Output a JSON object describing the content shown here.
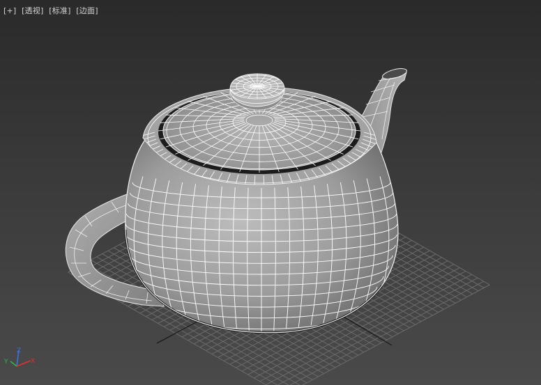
{
  "viewport": {
    "menus": [
      {
        "id": "plus",
        "label": "[+]"
      },
      {
        "id": "view",
        "label": "[透视]"
      },
      {
        "id": "shade",
        "label": "[标准]"
      },
      {
        "id": "edge",
        "label": "[边面]"
      }
    ]
  },
  "object": {
    "name": "teapot",
    "shading": "default shading + edged faces",
    "wire_color": "#ffffff",
    "surface_color": "#a9a9a9"
  },
  "axis_gizmo": {
    "x_label": "X",
    "y_label": "Y",
    "z_label": "Z",
    "colors": {
      "x": "#e0322d",
      "y": "#2fb84a",
      "z": "#3a72e0"
    }
  },
  "grid_color": "#6a6a6a"
}
